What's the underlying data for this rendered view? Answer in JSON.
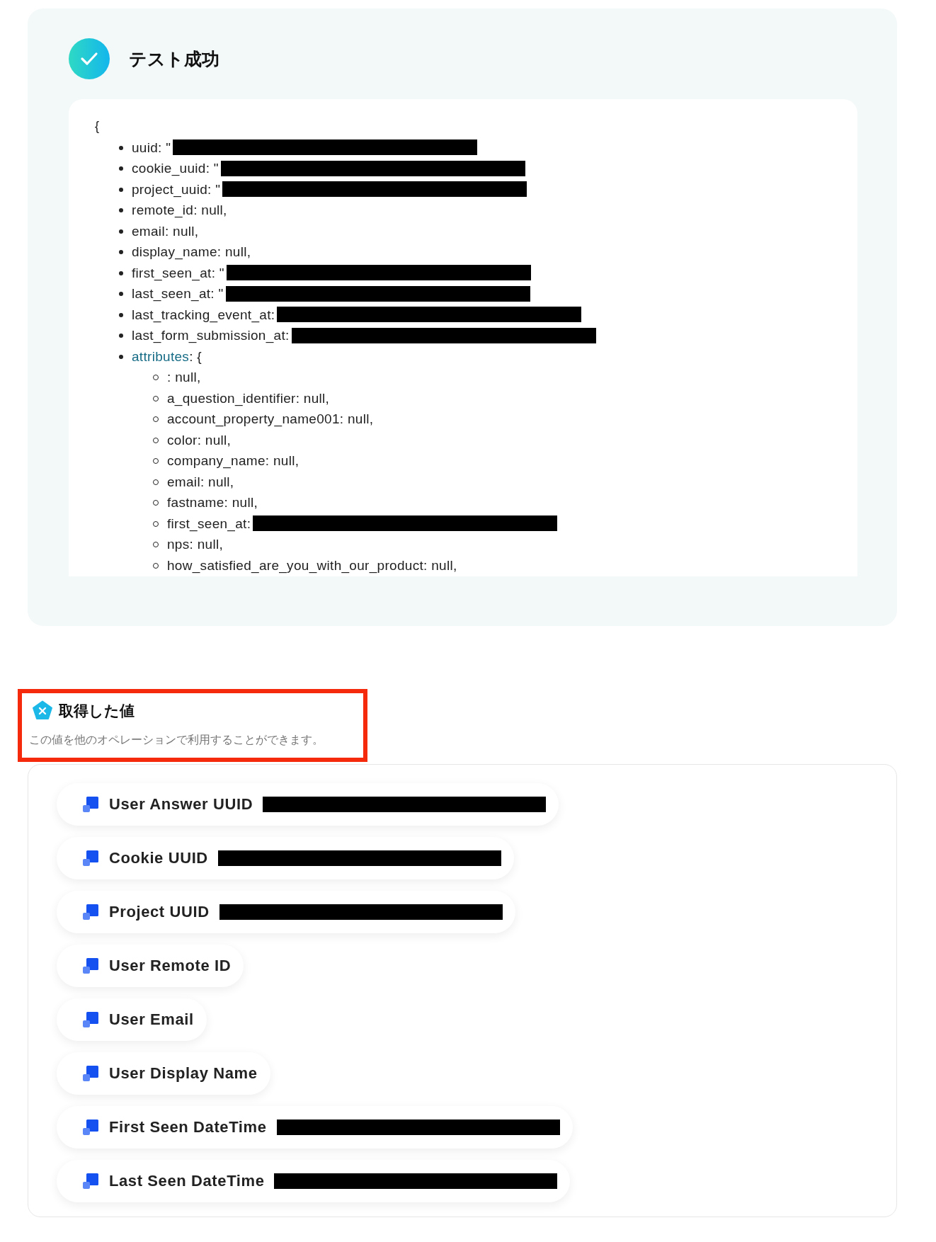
{
  "test_result": {
    "title": "テスト成功",
    "succeeded": true,
    "open_brace": "{",
    "fields": [
      {
        "text": "uuid: \"",
        "redacted": true
      },
      {
        "text": "cookie_uuid: \"",
        "redacted": true
      },
      {
        "text": "project_uuid: \"",
        "redacted": true
      },
      {
        "text": "remote_id: null,"
      },
      {
        "text": "email: null,"
      },
      {
        "text": "display_name: null,"
      },
      {
        "text": "first_seen_at: \"",
        "redacted": true
      },
      {
        "text": "last_seen_at: \"",
        "redacted": true
      },
      {
        "text": "last_tracking_event_at:",
        "redacted": true
      },
      {
        "text": "last_form_submission_at:",
        "redacted": true
      },
      {
        "key": "attributes",
        "text": ": {",
        "children": [
          {
            "text": ": null,"
          },
          {
            "text": "a_question_identifier: null,"
          },
          {
            "text": "account_property_name001: null,"
          },
          {
            "text": "color: null,"
          },
          {
            "text": "company_name: null,"
          },
          {
            "text": "email: null,"
          },
          {
            "text": "fastname: null,"
          },
          {
            "text": "first_seen_at:",
            "redacted": true
          },
          {
            "text": "nps: null,"
          },
          {
            "text": "how_satisfied_are_you_with_our_product: null,"
          }
        ]
      }
    ]
  },
  "obtained_values": {
    "title": "取得した値",
    "description": "この値を他のオペレーションで利用することができます。",
    "highlighted": true,
    "items": [
      {
        "label": "User Answer UUID",
        "redacted": true
      },
      {
        "label": "Cookie UUID",
        "redacted": true
      },
      {
        "label": "Project UUID",
        "redacted": true
      },
      {
        "label": "User Remote ID"
      },
      {
        "label": "User Email"
      },
      {
        "label": "User Display Name"
      },
      {
        "label": "First Seen DateTime",
        "redacted": true
      },
      {
        "label": "Last Seen DateTime",
        "redacted": true
      }
    ]
  }
}
